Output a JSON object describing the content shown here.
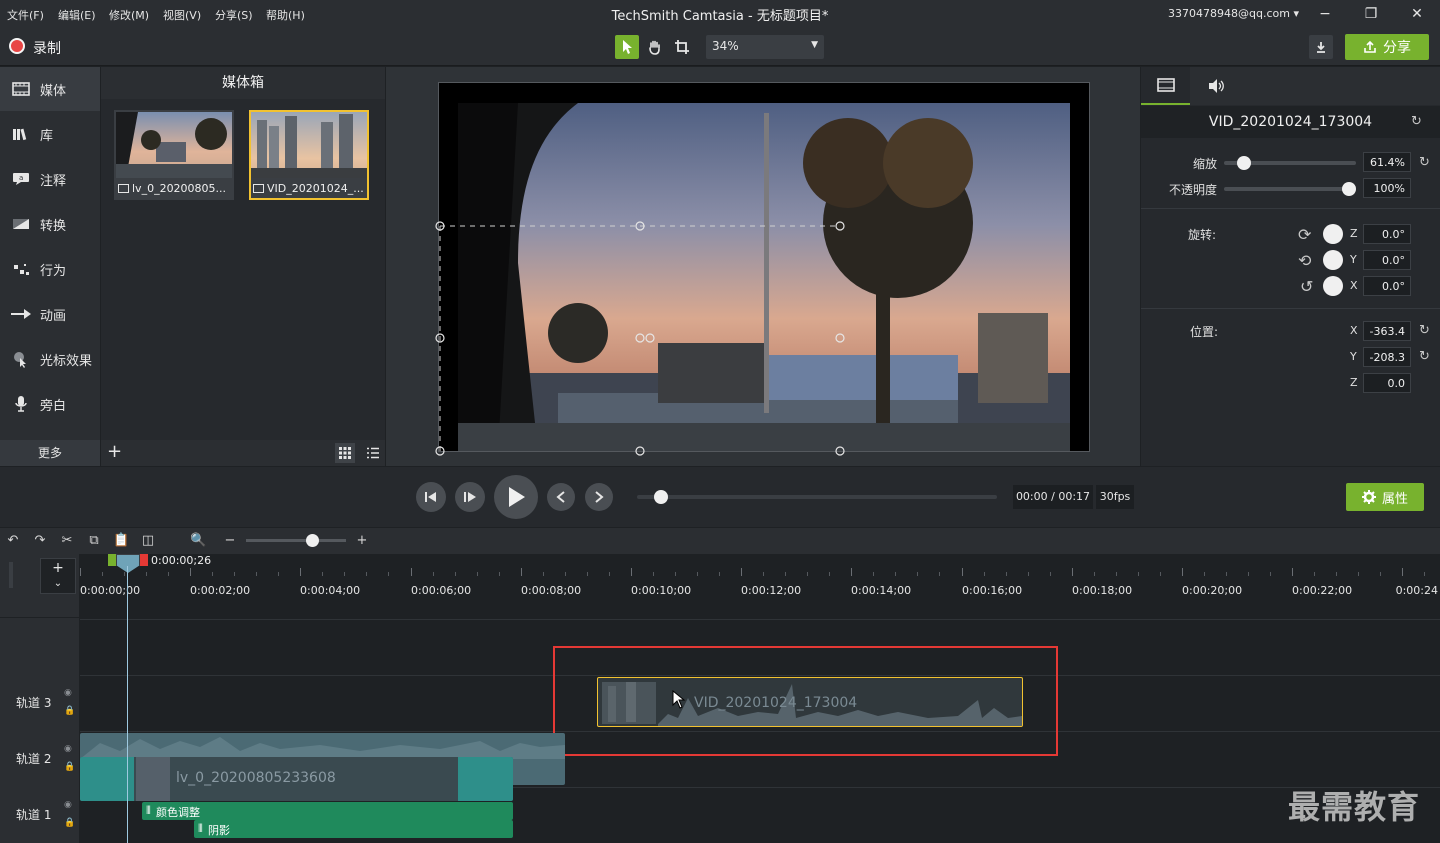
{
  "menu": [
    "文件(F)",
    "编辑(E)",
    "修改(M)",
    "视图(V)",
    "分享(S)",
    "帮助(H)"
  ],
  "app_title": "TechSmith Camtasia - 无标题项目*",
  "account": "3370478948@qq.com",
  "toolbar": {
    "record_label": "录制",
    "zoom": "34%",
    "share_label": "分享"
  },
  "sidebar": {
    "items": [
      {
        "label": "媒体",
        "icon": "film-icon"
      },
      {
        "label": "库",
        "icon": "library-icon"
      },
      {
        "label": "注释",
        "icon": "annotation-icon"
      },
      {
        "label": "转换",
        "icon": "transition-icon"
      },
      {
        "label": "行为",
        "icon": "behavior-icon"
      },
      {
        "label": "动画",
        "icon": "animation-icon"
      },
      {
        "label": "光标效果",
        "icon": "cursor-effect-icon"
      },
      {
        "label": "旁白",
        "icon": "microphone-icon"
      }
    ],
    "more_label": "更多"
  },
  "mediabin": {
    "title": "媒体箱",
    "items": [
      {
        "label": "lv_0_20200805..."
      },
      {
        "label": "VID_20201024_..."
      }
    ]
  },
  "properties": {
    "file_name": "VID_20201024_173004",
    "scale_label": "缩放",
    "scale_value": "61.4%",
    "scale_level": 0.15,
    "opacity_label": "不透明度",
    "opacity_value": "100%",
    "opacity_level": 1.0,
    "rotation_label": "旋转:",
    "rotation": [
      {
        "axis": "Z",
        "value": "0.0°"
      },
      {
        "axis": "Y",
        "value": "0.0°"
      },
      {
        "axis": "X",
        "value": "0.0°"
      }
    ],
    "position_label": "位置:",
    "position": [
      {
        "axis": "X",
        "value": "-363.4"
      },
      {
        "axis": "Y",
        "value": "-208.3"
      },
      {
        "axis": "Z",
        "value": "0.0"
      }
    ]
  },
  "playback": {
    "time": "00:00 / 00:17",
    "fps": "30fps",
    "properties_label": "属性",
    "progress": 0.05
  },
  "timeline": {
    "playhead_time": "0:00:00;26",
    "ticks": [
      "0:00:00;00",
      "0:00:02;00",
      "0:00:04;00",
      "0:00:06;00",
      "0:00:08;00",
      "0:00:10;00",
      "0:00:12;00",
      "0:00:14;00",
      "0:00:16;00",
      "0:00:18;00",
      "0:00:20;00",
      "0:00:22;00",
      "0:00:24"
    ],
    "tracks": [
      {
        "name": "轨道 3",
        "clip": "VID_20201024_173004"
      },
      {
        "name": "轨道 2",
        "clip": "lv_0_20200805233608"
      },
      {
        "name": "轨道 1",
        "effects": [
          "颜色调整",
          "阴影"
        ]
      }
    ]
  },
  "watermark": "最需教育",
  "colors": {
    "accent_green": "#78b22e",
    "selection_yellow": "#f2c230",
    "highlight_red": "#e53935",
    "record_red": "#e84545"
  }
}
